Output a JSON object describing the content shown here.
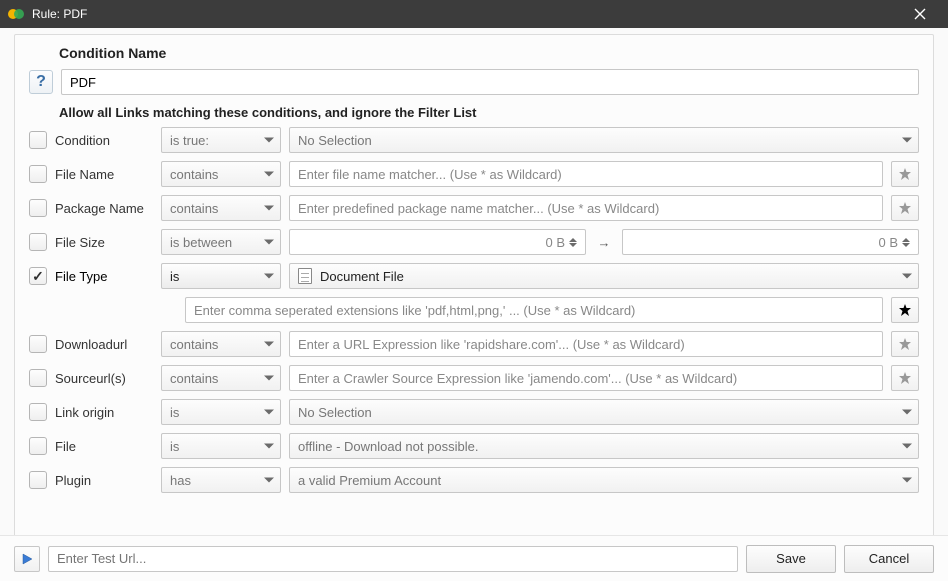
{
  "window": {
    "title": "Rule: PDF"
  },
  "header": {
    "condition_name_label": "Condition Name",
    "condition_name_value": "PDF",
    "subtitle": "Allow all Links matching these conditions, and ignore the Filter List"
  },
  "rows": {
    "condition": {
      "label": "Condition",
      "op": "is true:",
      "value": "No Selection"
    },
    "file_name": {
      "label": "File Name",
      "op": "contains",
      "placeholder": "Enter file name matcher... (Use * as Wildcard)"
    },
    "package": {
      "label": "Package Name",
      "op": "contains",
      "placeholder": "Enter predefined package name matcher... (Use * as Wildcard)"
    },
    "file_size": {
      "label": "File Size",
      "op": "is between",
      "from": "0 B",
      "to": "0 B"
    },
    "file_type": {
      "label": "File Type",
      "op": "is",
      "value": "Document File",
      "ext_placeholder": "Enter comma seperated extensions like 'pdf,html,png,' ... (Use * as Wildcard)"
    },
    "downloadurl": {
      "label": "Downloadurl",
      "op": "contains",
      "placeholder": "Enter a URL Expression like 'rapidshare.com'... (Use * as Wildcard)"
    },
    "sourceurl": {
      "label": "Sourceurl(s)",
      "op": "contains",
      "placeholder": "Enter a Crawler Source Expression like 'jamendo.com'... (Use * as Wildcard)"
    },
    "link_origin": {
      "label": "Link origin",
      "op": "is",
      "value": "No Selection"
    },
    "file": {
      "label": "File",
      "op": "is",
      "value": "offline - Download not possible."
    },
    "plugin": {
      "label": "Plugin",
      "op": "has",
      "value": "a valid Premium Account"
    }
  },
  "footer": {
    "test_placeholder": "Enter Test Url...",
    "save": "Save",
    "cancel": "Cancel"
  }
}
